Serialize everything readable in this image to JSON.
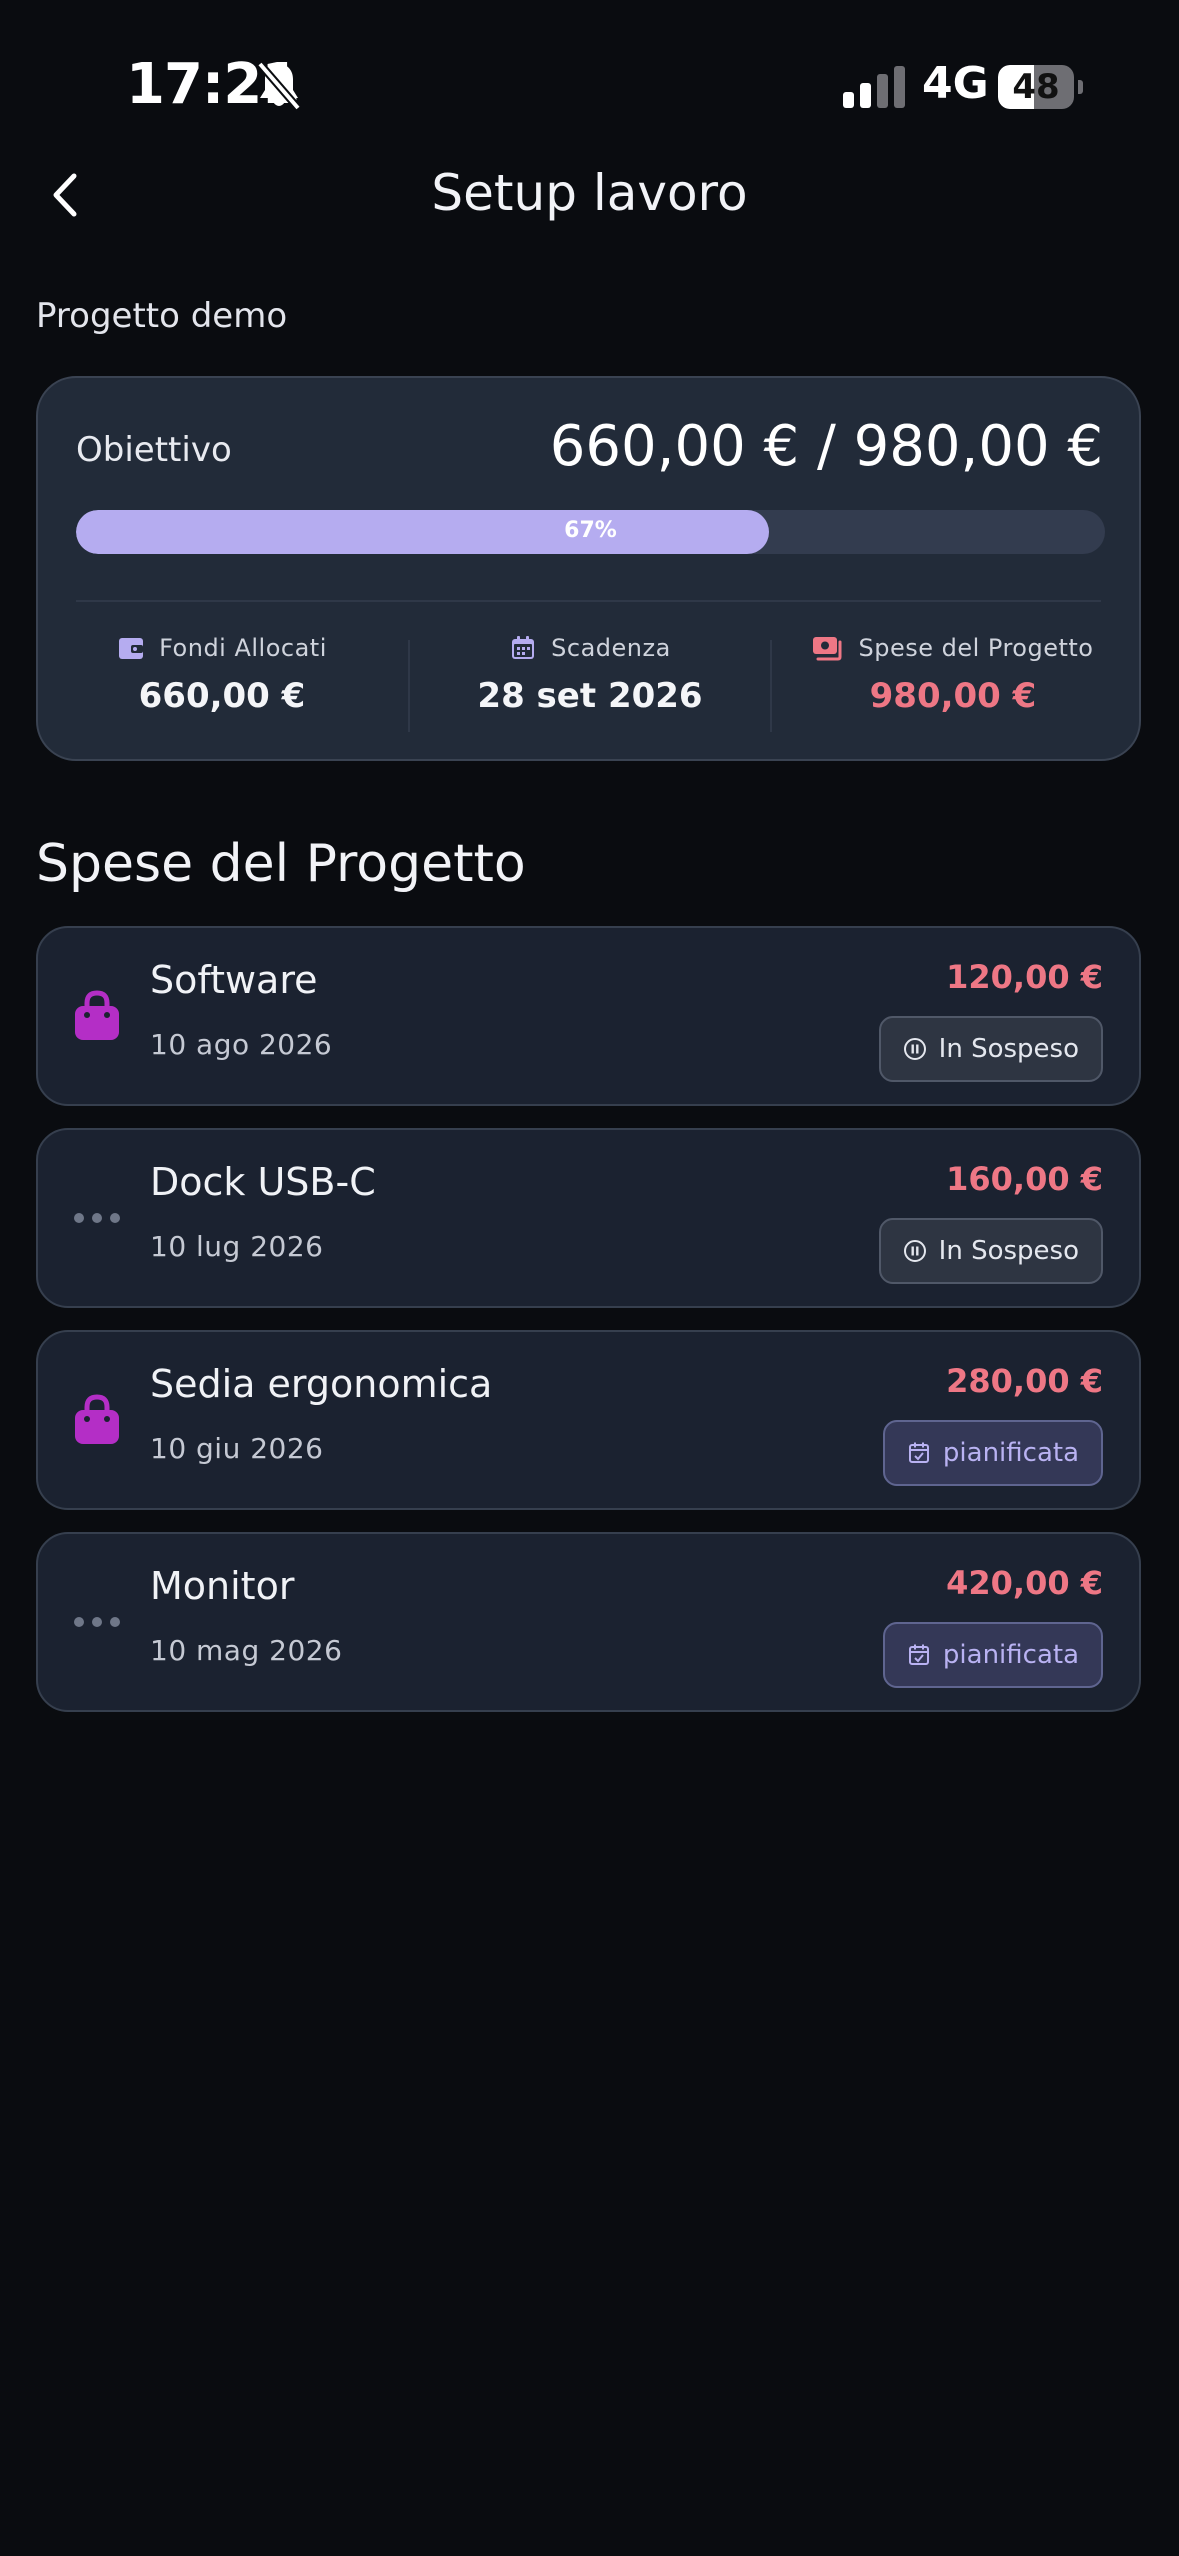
{
  "status_bar": {
    "time": "17:21",
    "network": "4G",
    "battery_level": "48",
    "battery_fraction": 0.48
  },
  "nav": {
    "title": "Setup lavoro"
  },
  "project": {
    "name": "Progetto demo"
  },
  "goal": {
    "label": "Obiettivo",
    "amounts": "660,00 € / 980,00 €",
    "progress_label": "67%",
    "progress_fraction": 0.673
  },
  "stats": [
    {
      "label": "Fondi Allocati",
      "value": "660,00 €",
      "icon": "wallet-icon"
    },
    {
      "label": "Scadenza",
      "value": "28 set 2026",
      "icon": "calendar-icon"
    },
    {
      "label": "Spese del Progetto",
      "value": "980,00 €",
      "icon": "cash-icon"
    }
  ],
  "section": {
    "title": "Spese del Progetto"
  },
  "expenses": [
    {
      "name": "Software",
      "date": "10 ago 2026",
      "amount": "120,00 €",
      "status": "In Sospeso",
      "icon": "shopping-bag-icon"
    },
    {
      "name": "Dock USB-C",
      "date": "10 lug 2026",
      "amount": "160,00 €",
      "status": "In Sospeso",
      "icon": "more-dots-icon"
    },
    {
      "name": "Sedia ergonomica",
      "date": "10 giu 2026",
      "amount": "280,00 €",
      "status": "pianificata",
      "icon": "shopping-bag-icon"
    },
    {
      "name": "Monitor",
      "date": "10 mag 2026",
      "amount": "420,00 €",
      "status": "pianificata",
      "icon": "more-dots-icon"
    }
  ],
  "colors": {
    "background": "#0a0c10",
    "card": "#222b39",
    "accent": "#b5acf0",
    "expense": "#ee7785",
    "bag_icon": "#b42ec6"
  }
}
